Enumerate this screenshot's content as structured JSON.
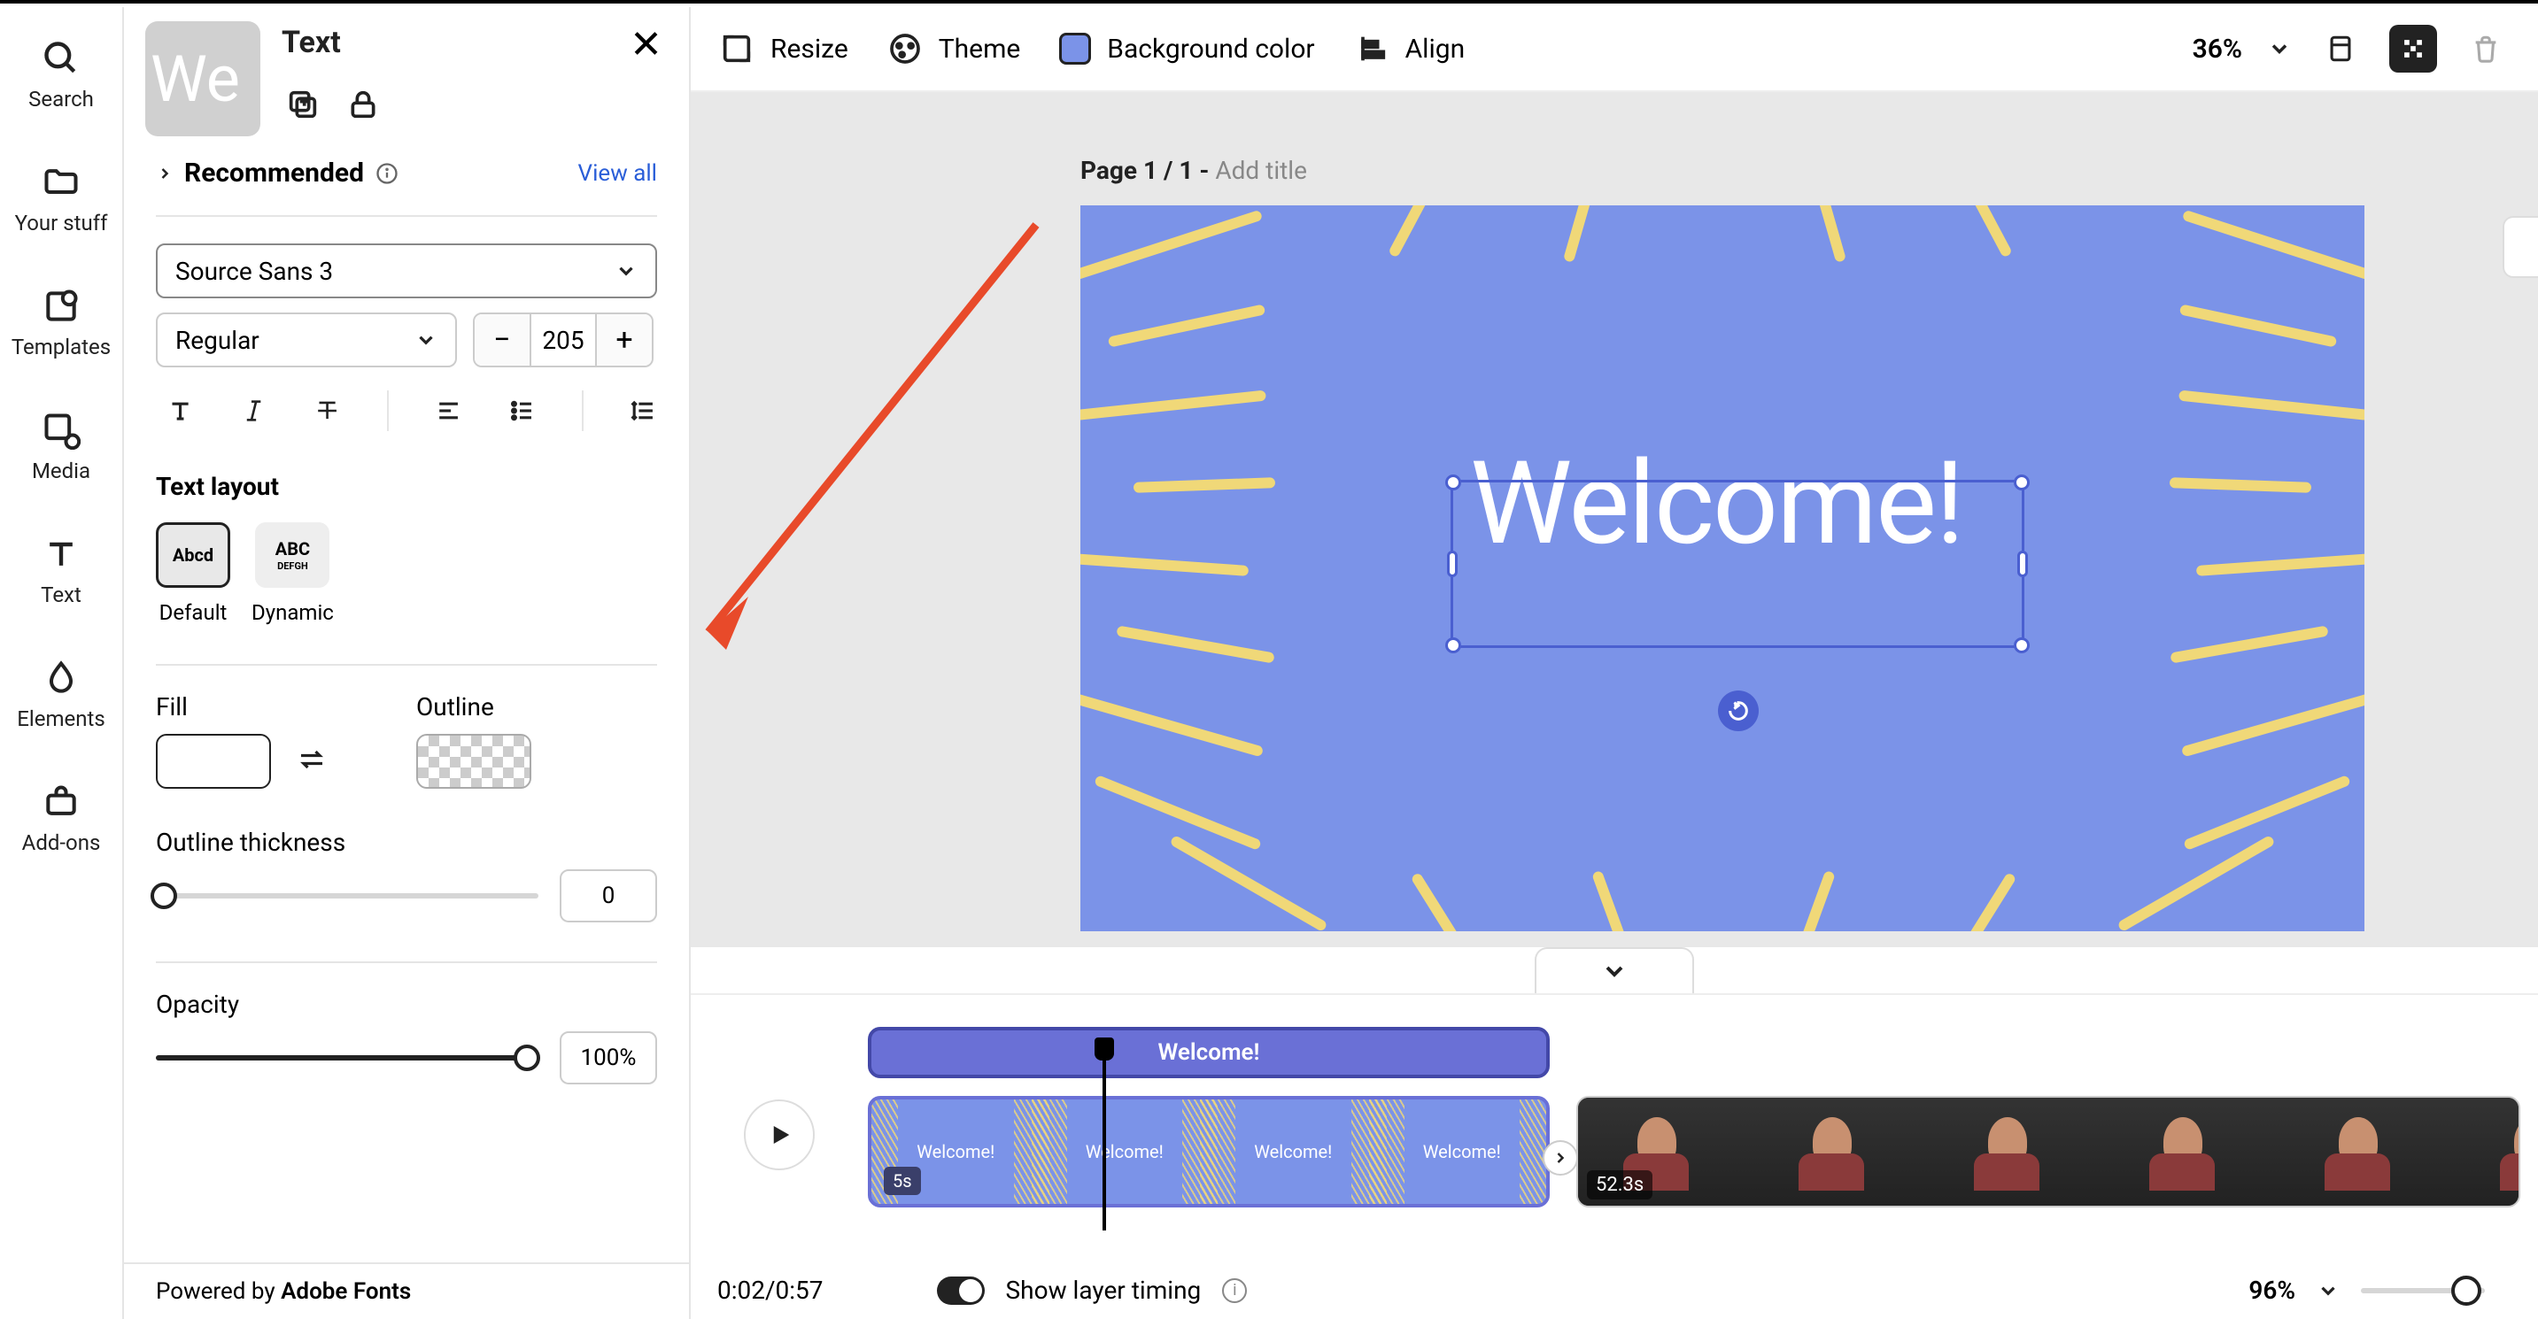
{
  "left_rail": [
    {
      "label": "Search",
      "icon": "search-icon"
    },
    {
      "label": "Your stuff",
      "icon": "folder-icon"
    },
    {
      "label": "Templates",
      "icon": "templates-icon"
    },
    {
      "label": "Media",
      "icon": "media-icon"
    },
    {
      "label": "Text",
      "icon": "text-icon"
    },
    {
      "label": "Elements",
      "icon": "elements-icon"
    },
    {
      "label": "Add-ons",
      "icon": "addons-icon"
    }
  ],
  "panel": {
    "title": "Text",
    "thumb_preview": "We",
    "recommended_label": "Recommended",
    "view_all": "View all",
    "font_family": "Source Sans 3",
    "font_weight": "Regular",
    "font_size": "205",
    "text_layout_label": "Text layout",
    "layout_options": [
      {
        "name": "Default",
        "sample": "Abcd"
      },
      {
        "name": "Dynamic",
        "sample_big": "ABC",
        "sample_small": "DEFGH"
      }
    ],
    "fill_label": "Fill",
    "outline_label": "Outline",
    "outline_thickness_label": "Outline thickness",
    "outline_thickness_value": "0",
    "opacity_label": "Opacity",
    "opacity_value": "100%",
    "footer_prefix": "Powered by ",
    "footer_link": "Adobe Fonts"
  },
  "topbar": {
    "resize": "Resize",
    "theme": "Theme",
    "bg": "Background color",
    "align": "Align",
    "zoom": "36%"
  },
  "canvas": {
    "page_prefix": "Page 1 / 1 - ",
    "add_title": "Add title",
    "text": "Welcome!",
    "bg_color": "#7b93e8",
    "ray_color": "#f0d878"
  },
  "timeline": {
    "text_clip": "Welcome!",
    "scene_preview": "Welcome!",
    "scene_duration": "5s",
    "video_duration": "52.3s",
    "time_display": "0:02/0:57",
    "show_layer_timing": "Show layer timing",
    "zoom": "96%"
  }
}
